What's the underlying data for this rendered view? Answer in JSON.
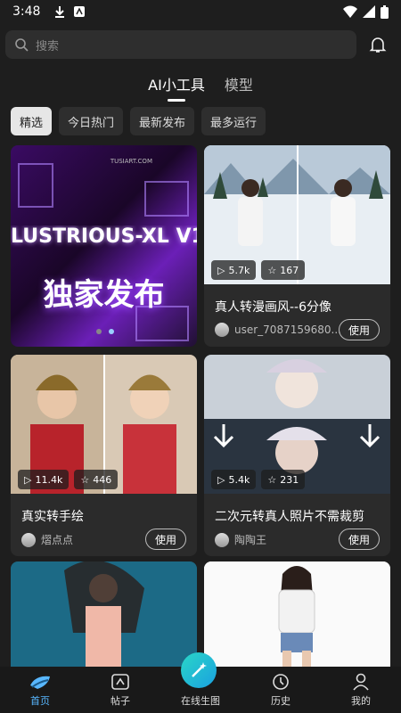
{
  "status_bar": {
    "time": "3:48"
  },
  "search": {
    "placeholder": "搜索"
  },
  "top_tabs": [
    {
      "label": "AI小工具",
      "active": true
    },
    {
      "label": "模型",
      "active": false
    }
  ],
  "filters": [
    {
      "label": "精选",
      "active": true
    },
    {
      "label": "今日热门",
      "active": false
    },
    {
      "label": "最新发布",
      "active": false
    },
    {
      "label": "最多运行",
      "active": false
    }
  ],
  "banner": {
    "brand": "TUSIART.COM",
    "headline": "LUSTRIOUS-XL V1",
    "subtitle": "独家发布",
    "dots": 2,
    "active_dot": 1
  },
  "cards": [
    {
      "views": "5.7k",
      "likes": "167",
      "title": "真人转漫画风--6分像",
      "author": "user_7087159680...",
      "use_label": "使用"
    },
    {
      "views": "11.4k",
      "likes": "446",
      "title": "真实转手绘",
      "author": "熠点点",
      "use_label": "使用"
    },
    {
      "views": "5.4k",
      "likes": "231",
      "title": "二次元转真人照片不需裁剪",
      "author": "陶陶王",
      "use_label": "使用"
    }
  ],
  "bottom_nav": [
    {
      "label": "首页",
      "icon": "home-icon",
      "active": true
    },
    {
      "label": "帖子",
      "icon": "posts-icon",
      "active": false
    },
    {
      "label": "在线生图",
      "icon": "magic-wand-icon",
      "active": false
    },
    {
      "label": "历史",
      "icon": "history-icon",
      "active": false
    },
    {
      "label": "我的",
      "icon": "profile-icon",
      "active": false
    }
  ],
  "colors": {
    "accent": "#58b7ff",
    "fab": "#1aa0e0",
    "background": "#1e1e1e"
  }
}
